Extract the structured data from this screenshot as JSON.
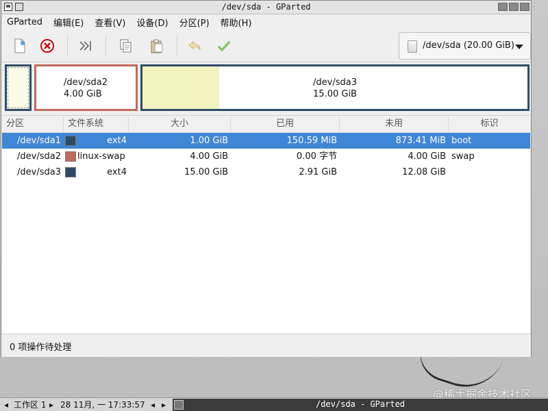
{
  "window": {
    "title": "/dev/sda - GParted"
  },
  "menubar": {
    "items": [
      "GParted",
      "编辑(E)",
      "查看(V)",
      "设备(D)",
      "分区(P)",
      "帮助(H)"
    ]
  },
  "toolbar": {
    "icons": [
      "new-partition-icon",
      "delete-icon",
      "resize-move-icon",
      "copy-icon",
      "paste-icon",
      "undo-icon",
      "apply-icon"
    ],
    "device_selector": "/dev/sda (20.00 GiB)"
  },
  "partition_map": {
    "sda2": {
      "name": "/dev/sda2",
      "size": "4.00 GiB"
    },
    "sda3": {
      "name": "/dev/sda3",
      "size": "15.00 GiB",
      "used_fraction": 0.2
    }
  },
  "table": {
    "headers": [
      "分区",
      "文件系统",
      "大小",
      "已用",
      "未用",
      "标识"
    ],
    "rows": [
      {
        "partition": "/dev/sda1",
        "fs": "ext4",
        "size": "1.00 GiB",
        "used": "150.59 MiB",
        "unused": "873.41 MiB",
        "flags": "boot",
        "color": "#2e4b66",
        "selected": true
      },
      {
        "partition": "/dev/sda2",
        "fs": "linux-swap",
        "size": "4.00 GiB",
        "used": "0.00 字节",
        "unused": "4.00 GiB",
        "flags": "swap",
        "color": "#c16a5a",
        "selected": false
      },
      {
        "partition": "/dev/sda3",
        "fs": "ext4",
        "size": "15.00 GiB",
        "used": "2.91 GiB",
        "unused": "12.08 GiB",
        "flags": "",
        "color": "#2e4b66",
        "selected": false
      }
    ]
  },
  "status": {
    "text": "0 项操作待处理"
  },
  "taskbar": {
    "workspace": "工作区 1",
    "datetime": "28 11月, 一 17:33:57",
    "active_task": "/dev/sda - GParted"
  },
  "watermark": "@稀土掘金技术社区",
  "colors": {
    "selection": "#3f86d6",
    "ext4": "#2e4b66",
    "swap": "#c16a5a",
    "used": "#f3f3bf"
  }
}
